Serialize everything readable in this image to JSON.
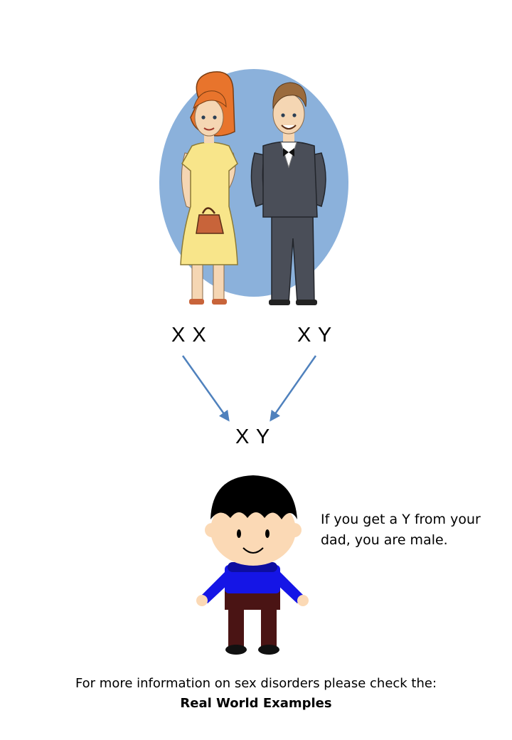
{
  "parents": {
    "mother_chromosomes": "X X",
    "father_chromosomes": "X Y"
  },
  "child": {
    "chromosomes": "X Y",
    "note_line1": "If you get a Y from your",
    "note_line2": "dad, you are male."
  },
  "footer": {
    "line1": "For more information on sex disorders please check the:",
    "line2": "Real World Examples"
  },
  "colors": {
    "oval": "#8bb1db",
    "arrow": "#4f81bd",
    "dress": "#f8e58a",
    "hair_mother": "#e8742c",
    "suit": "#4a4e58",
    "shirt_child": "#1515e6",
    "pants_child": "#4a1414"
  }
}
